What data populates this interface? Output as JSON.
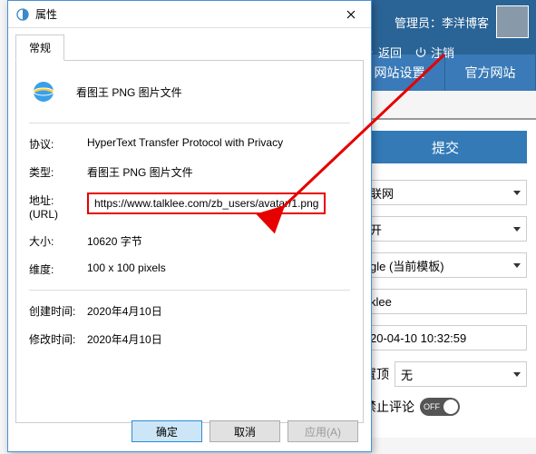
{
  "dialog": {
    "title": "属性",
    "tab": "常规",
    "file_name": "看图王 PNG 图片文件",
    "rows": {
      "protocol_label": "协议:",
      "protocol_value": "HyperText Transfer Protocol with Privacy",
      "type_label": "类型:",
      "type_value": "看图王 PNG 图片文件",
      "url_label": "地址:",
      "url_sub": "(URL)",
      "url_value": "https://www.talklee.com/zb_users/avatar/1.png",
      "size_label": "大小:",
      "size_value": "10620 字节",
      "dim_label": "维度:",
      "dim_value": "100  x  100  pixels",
      "created_label": "创建时间:",
      "created_value": "2020年4月10日",
      "modified_label": "修改时间:",
      "modified_value": "2020年4月10日"
    },
    "buttons": {
      "ok": "确定",
      "cancel": "取消",
      "apply": "应用(A)"
    }
  },
  "admin": {
    "user_prefix": "管理员：",
    "user_name": "李洋博客",
    "back": "返回",
    "logout": "注销",
    "nav1": "网站设置",
    "nav2": "官方网站",
    "submit": "提交",
    "fields": {
      "f1": "联网",
      "f2": "开",
      "f3": "gle (当前模板)",
      "f4": "klee",
      "f5": "20-04-10 10:32:59"
    },
    "pin_label": "置顶",
    "pin_value": "无",
    "comment_label": "禁止评论",
    "toggle_text": "OFF"
  }
}
